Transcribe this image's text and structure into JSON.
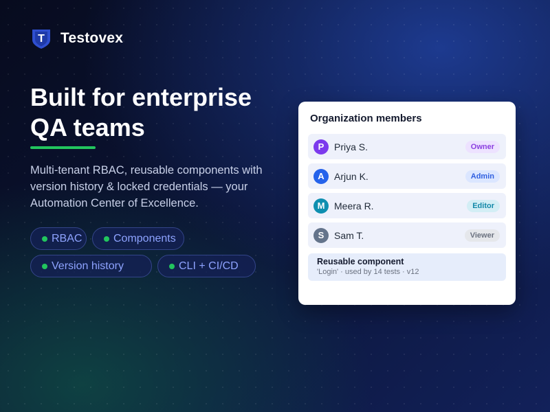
{
  "brand": {
    "name": "Testovex",
    "logo_icon": "shield-t-logo-icon",
    "logo_color": "#2f4fd0",
    "logo_letter": "T"
  },
  "hero": {
    "headline_line1": "Built for enterprise",
    "headline_line2": "QA teams",
    "accent_color": "#22c55e",
    "description": "Multi-tenant RBAC, reusable components with version history & locked credentials — your Automation Center of Excellence."
  },
  "features": [
    {
      "label": "RBAC"
    },
    {
      "label": "Components"
    },
    {
      "label": "Version history"
    },
    {
      "label": "CLI + CI/CD"
    }
  ],
  "org_card": {
    "title": "Organization members",
    "members": [
      {
        "initial": "P",
        "name": "Priya S.",
        "role": "Owner",
        "avatar_color": "#7c3aed",
        "badge_bg": "#ede2ff",
        "badge_fg": "#8b3fe0"
      },
      {
        "initial": "A",
        "name": "Arjun K.",
        "role": "Admin",
        "avatar_color": "#2563eb",
        "badge_bg": "#dbe6ff",
        "badge_fg": "#2f5fe0"
      },
      {
        "initial": "M",
        "name": "Meera R.",
        "role": "Editor",
        "avatar_color": "#0e8fb0",
        "badge_bg": "#d3eef5",
        "badge_fg": "#1288a8"
      },
      {
        "initial": "S",
        "name": "Sam T.",
        "role": "Viewer",
        "avatar_color": "#64748b",
        "badge_bg": "#e5e7eb",
        "badge_fg": "#6b7280"
      }
    ],
    "component": {
      "title": "Reusable component",
      "meta": "'Login' · used by 14 tests · v12"
    }
  }
}
